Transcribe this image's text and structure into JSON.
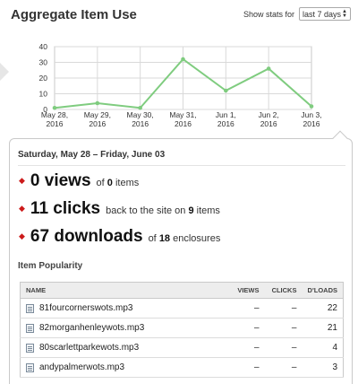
{
  "header": {
    "title": "Aggregate Item Use",
    "stats_label": "Show stats for",
    "range_selected": "last 7 days"
  },
  "chart_data": {
    "type": "line",
    "categories": [
      "May 28,\n2016",
      "May 29,\n2016",
      "May 30,\n2016",
      "May 31,\n2016",
      "Jun 1,\n2016",
      "Jun 2,\n2016",
      "Jun 3,\n2016"
    ],
    "values": [
      1,
      4,
      1,
      32,
      12,
      26,
      2
    ],
    "ylim": [
      0,
      40
    ],
    "yticks": [
      0,
      10,
      20,
      30,
      40
    ],
    "grid": true,
    "line_color": "#7fcc7f"
  },
  "summary": {
    "date_range": "Saturday, May 28 – Friday, June 03",
    "views": {
      "count": "0 views",
      "text_before": "of",
      "bold": "0",
      "text_after": "items"
    },
    "clicks": {
      "count": "11 clicks",
      "text_before": "back to the site on",
      "bold": "9",
      "text_after": "items"
    },
    "downloads": {
      "count": "67 downloads",
      "text_before": "of",
      "bold": "18",
      "text_after": "enclosures"
    }
  },
  "popularity": {
    "heading": "Item Popularity",
    "columns": {
      "name": "NAME",
      "views": "VIEWS",
      "clicks": "CLICKS",
      "dloads": "D'LOADS"
    },
    "rows": [
      {
        "name": "81fourcornerswots.mp3",
        "views": "–",
        "clicks": "–",
        "dloads": "22"
      },
      {
        "name": "82morganhenleywots.mp3",
        "views": "–",
        "clicks": "–",
        "dloads": "21"
      },
      {
        "name": "80scarlettparkewots.mp3",
        "views": "–",
        "clicks": "–",
        "dloads": "4"
      },
      {
        "name": "andypalmerwots.mp3",
        "views": "–",
        "clicks": "–",
        "dloads": "3"
      }
    ]
  }
}
